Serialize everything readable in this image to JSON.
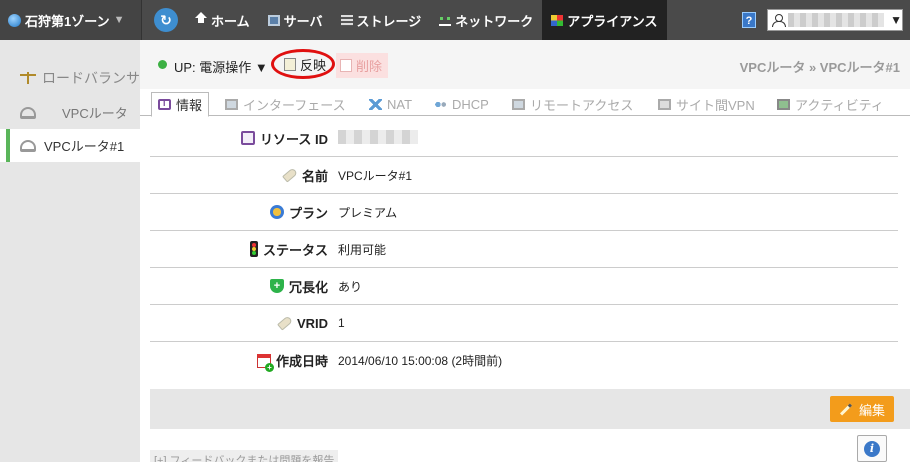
{
  "topbar": {
    "zone_label": "石狩第1ゾーン",
    "zone_caret": "▼",
    "refresh_icon": "↻",
    "nav": [
      {
        "label": "ホーム",
        "icon": "home-icon"
      },
      {
        "label": "サーバ",
        "icon": "server-icon"
      },
      {
        "label": "ストレージ",
        "icon": "storage-icon"
      },
      {
        "label": "ネットワーク",
        "icon": "network-icon"
      },
      {
        "label": "アプライアンス",
        "icon": "appliance-icon",
        "active": true
      }
    ],
    "help_label": "?",
    "user_caret": "▼"
  },
  "sidebar": {
    "section_label": "ロードバランサ",
    "items": [
      {
        "label": "VPCルータ"
      },
      {
        "label": "VPCルータ#1",
        "selected": true
      }
    ]
  },
  "actionbar": {
    "status_text": "UP: 電源操作 ▼",
    "status_color": "#3cb043",
    "reflect_label": "反映",
    "delete_label": "削除",
    "breadcrumb": "VPCルータ » VPCルータ#1"
  },
  "tabs": [
    {
      "label": "情報",
      "active": true
    },
    {
      "label": "インターフェース"
    },
    {
      "label": "NAT"
    },
    {
      "label": "DHCP"
    },
    {
      "label": "リモートアクセス"
    },
    {
      "label": "サイト間VPN"
    },
    {
      "label": "アクティビティ"
    }
  ],
  "details": {
    "resource_id_label": "リソース ID",
    "name_label": "名前",
    "name_value": "VPCルータ#1",
    "plan_label": "プラン",
    "plan_value": "プレミアム",
    "status_label": "ステータス",
    "status_value": "利用可能",
    "redundancy_label": "冗長化",
    "redundancy_value": "あり",
    "vrid_label": "VRID",
    "vrid_value": "1",
    "created_label": "作成日時",
    "created_value": "2014/06/10 15:00:08 (2時間前)"
  },
  "footer": {
    "edit_label": "編集",
    "info_label": "i",
    "feedback_text": "[+] フィードバックまたは問題を報告"
  },
  "colors": {
    "topbar": "#4a4a4a",
    "accent_orange": "#f39c1b",
    "highlight_ring": "#e01010",
    "sidebar_selected": "#5ab55a"
  }
}
